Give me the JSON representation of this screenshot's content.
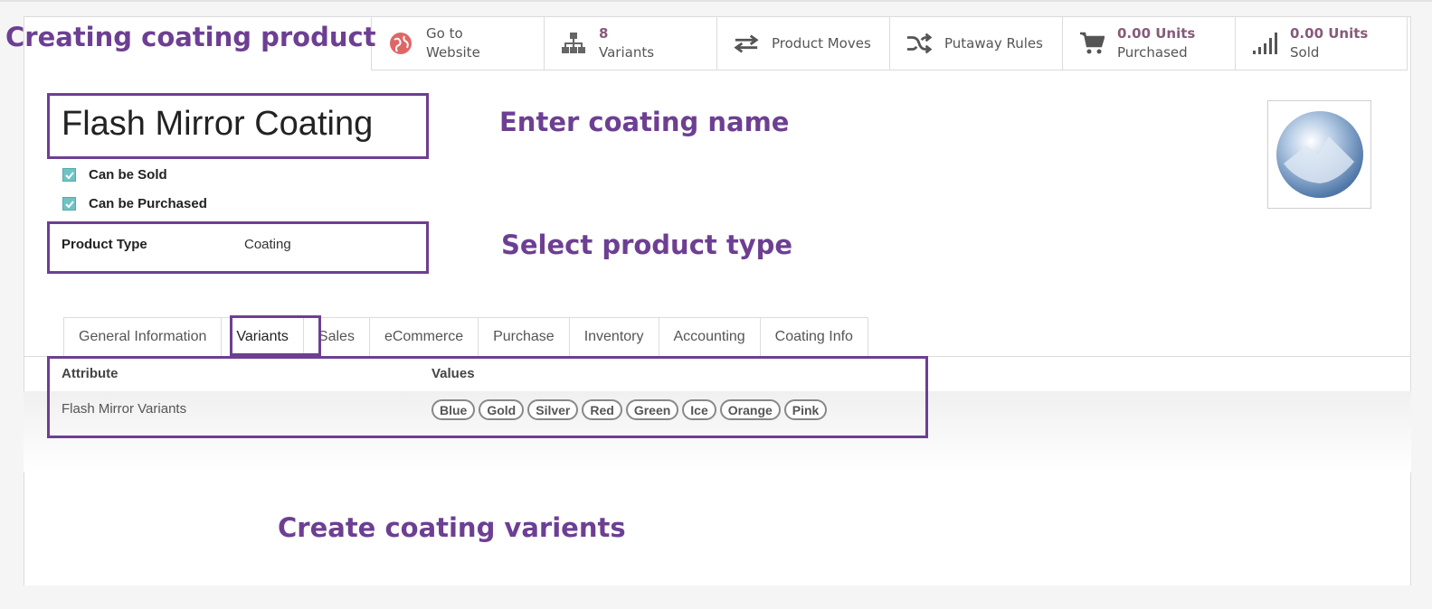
{
  "annotations": {
    "creating": "Creating coating product",
    "name": "Enter coating name",
    "type": "Select product type",
    "variants": "Create coating varients"
  },
  "smart_buttons": [
    {
      "icon": "globe-icon",
      "line1": "Go to",
      "line2": "Website"
    },
    {
      "icon": "sitemap-icon",
      "line1": "8",
      "line2": "Variants"
    },
    {
      "icon": "exchange-icon",
      "line1": "Product Moves",
      "line2": ""
    },
    {
      "icon": "random-icon",
      "line1": "Putaway Rules",
      "line2": ""
    },
    {
      "icon": "cart-icon",
      "line1": "0.00 Units",
      "line2": "Purchased"
    },
    {
      "icon": "signal-icon",
      "line1": "0.00 Units",
      "line2": "Sold"
    }
  ],
  "product": {
    "name": "Flash Mirror Coating",
    "can_be_sold": "Can be Sold",
    "can_be_purchased": "Can be Purchased",
    "type_label": "Product Type",
    "type_value": "Coating"
  },
  "tabs": [
    "General Information",
    "Variants",
    "Sales",
    "eCommerce",
    "Purchase",
    "Inventory",
    "Accounting",
    "Coating Info"
  ],
  "variants_table": {
    "headers": [
      "Attribute",
      "Values"
    ],
    "attribute": "Flash Mirror Variants",
    "values": [
      "Blue",
      "Gold",
      "Silver",
      "Red",
      "Green",
      "Ice",
      "Orange",
      "Pink"
    ]
  },
  "colors": {
    "accent": "#6d3f93",
    "brand": "#875a7b",
    "checkbox": "#6ec4c4"
  }
}
